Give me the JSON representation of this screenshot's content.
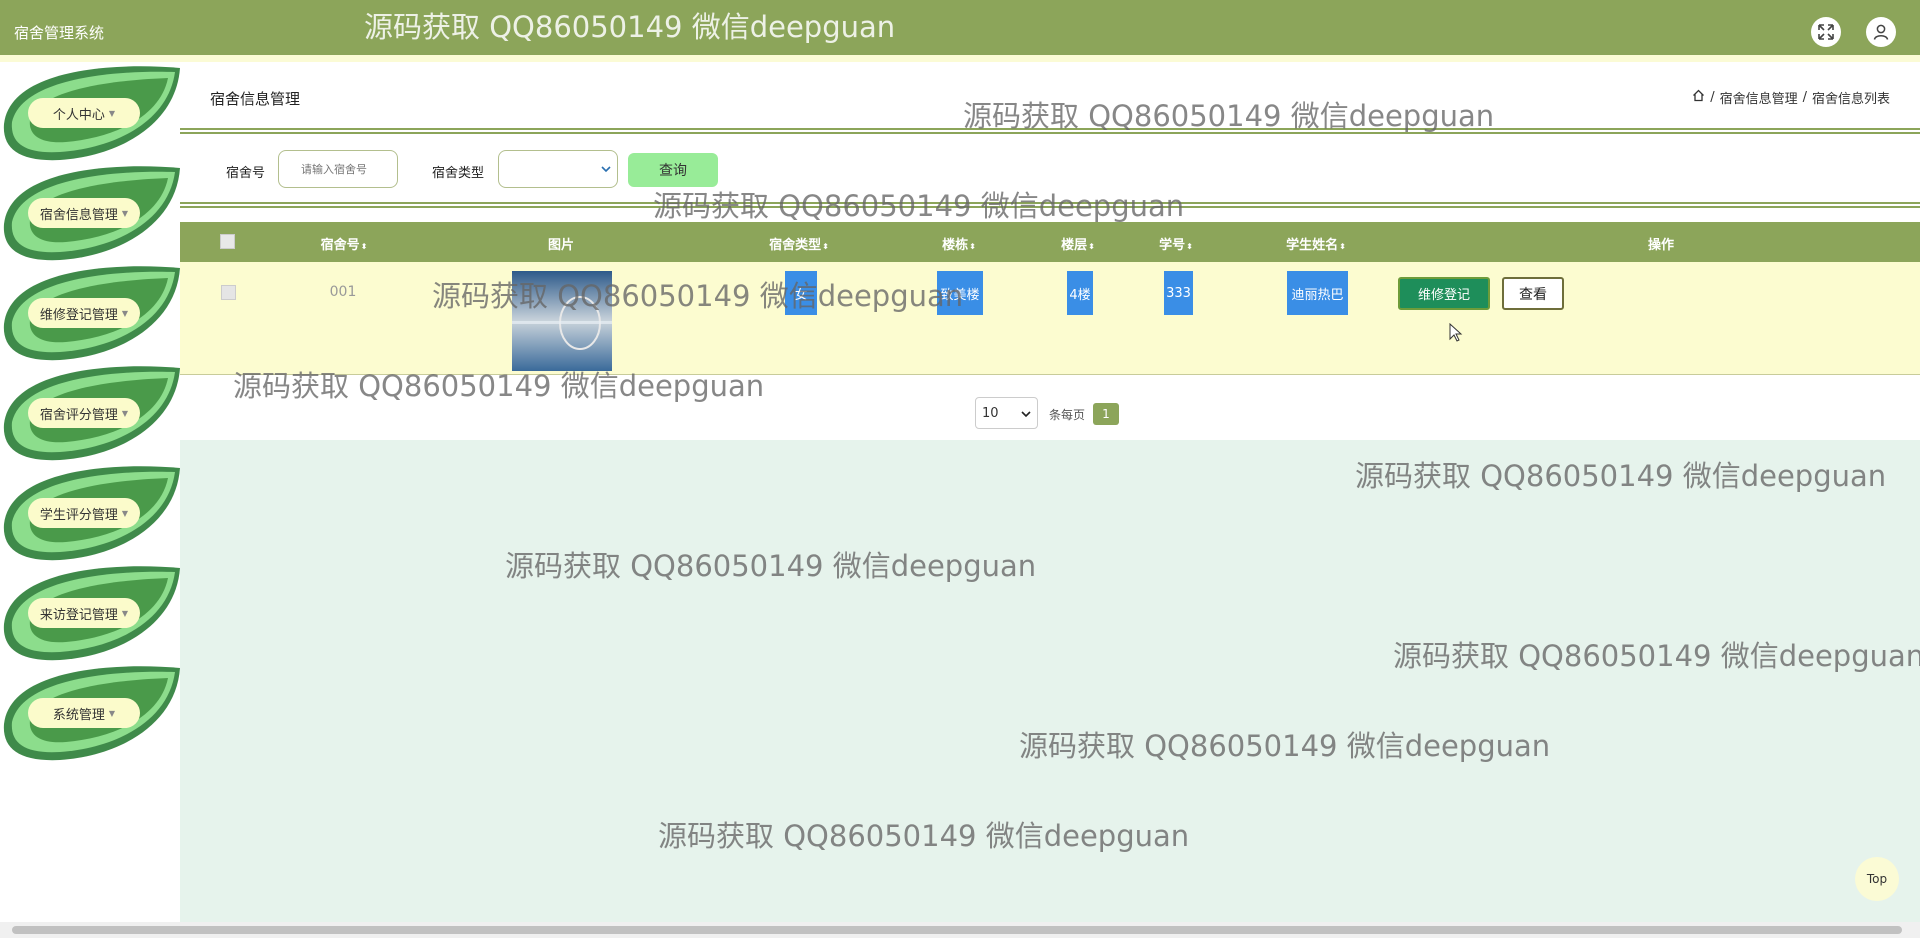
{
  "app": {
    "title": "宿舍管理系统"
  },
  "header": {
    "watermark": "源码获取 QQ86050149 微信deepguan",
    "fullscreen_icon": "expand-icon",
    "user_icon": "user-icon"
  },
  "sidebar": {
    "items": [
      {
        "label": "个人中心"
      },
      {
        "label": "宿舍信息管理"
      },
      {
        "label": "维修登记管理"
      },
      {
        "label": "宿舍评分管理"
      },
      {
        "label": "学生评分管理"
      },
      {
        "label": "来访登记管理"
      },
      {
        "label": "系统管理"
      }
    ]
  },
  "page": {
    "title": "宿舍信息管理",
    "breadcrumb": [
      "宿舍信息管理",
      "宿舍信息列表"
    ]
  },
  "filters": {
    "dorm_no_label": "宿舍号",
    "dorm_no_placeholder": "请输入宿舍号",
    "dorm_type_label": "宿舍类型",
    "query_label": "查询"
  },
  "table": {
    "columns": [
      "宿舍号",
      "图片",
      "宿舍类型",
      "楼栋",
      "楼层",
      "学号",
      "学生姓名",
      "操作"
    ],
    "rows": [
      {
        "dorm_no": "001",
        "dorm_type": "女",
        "building": "致美楼",
        "floor": "4楼",
        "student_no": "333",
        "student_name": "迪丽热巴"
      }
    ],
    "actions": {
      "repair": "维修登记",
      "view": "查看"
    }
  },
  "pagination": {
    "page_size": "10",
    "per_page_label": "条每页",
    "current_page": "1"
  },
  "watermark_text": "源码获取 QQ86050149 微信deepguan",
  "top_button": "Top",
  "colors": {
    "header": "#8ca55a",
    "accent": "#98ec98",
    "tag": "#3a8ee6",
    "row": "#fcfcd0"
  }
}
